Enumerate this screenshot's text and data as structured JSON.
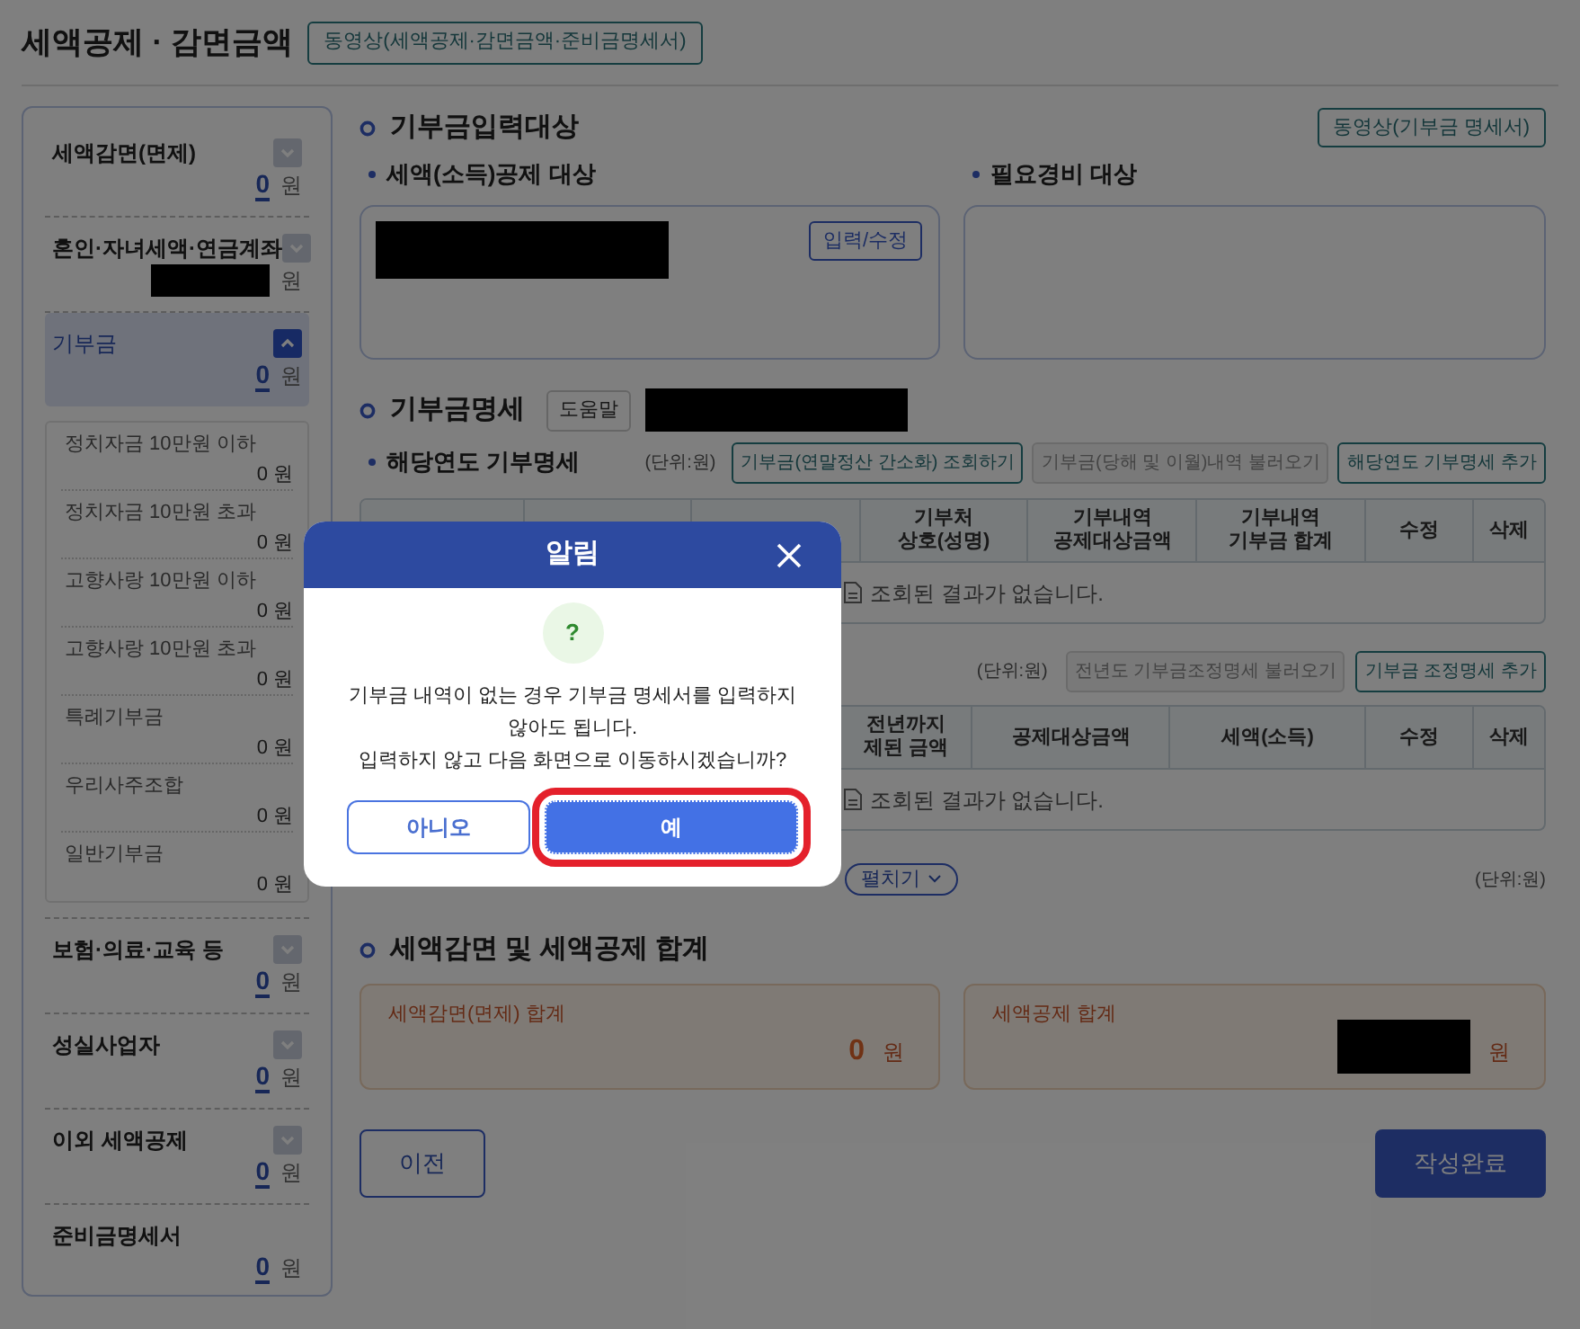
{
  "page_title": "세액공제 · 감면금액",
  "video_button": "동영상(세액공제·감면금액·준비금명세서)",
  "sidebar": {
    "items": [
      {
        "label": "세액감면(면제)",
        "amount": "0",
        "unit": "원",
        "selected": false,
        "expanded": false
      },
      {
        "label": "혼인·자녀세액·연금계좌",
        "unit": "원",
        "selected": false,
        "expanded": false
      },
      {
        "label": "기부금",
        "amount": "0",
        "unit": "원",
        "selected": true,
        "expanded": true,
        "children": [
          {
            "label": "정치자금 10만원 이하",
            "amount": "0 원"
          },
          {
            "label": "정치자금 10만원 초과",
            "amount": "0 원"
          },
          {
            "label": "고향사랑 10만원 이하",
            "amount": "0 원"
          },
          {
            "label": "고향사랑 10만원 초과",
            "amount": "0 원"
          },
          {
            "label": "특례기부금",
            "amount": "0 원"
          },
          {
            "label": "우리사주조합",
            "amount": "0 원"
          },
          {
            "label": "일반기부금",
            "amount": "0 원"
          }
        ]
      },
      {
        "label": "보험·의료·교육 등",
        "amount": "0",
        "unit": "원",
        "selected": false,
        "expanded": false
      },
      {
        "label": "성실사업자",
        "amount": "0",
        "unit": "원",
        "selected": false,
        "expanded": false
      },
      {
        "label": "이외 세액공제",
        "amount": "0",
        "unit": "원",
        "selected": false,
        "expanded": false
      },
      {
        "label": "준비금명세서",
        "amount": "0",
        "unit": "원",
        "selected": false
      }
    ]
  },
  "input_target": {
    "title": "기부금입력대상",
    "video_button": "동영상(기부금 명세서)",
    "deduction_label": "세액(소득)공제 대상",
    "edit_button": "입력/수정",
    "expense_label": "필요경비 대상"
  },
  "donation_detail": {
    "title": "기부금명세",
    "help_button": "도움말",
    "subtitle": "해당연도 기부명세",
    "unit": "(단위:원)",
    "buttons": [
      {
        "label": "기부금(연말정산 간소화) 조회하기",
        "disabled": false
      },
      {
        "label": "기부금(당해 및 이월)내역 불러오기",
        "disabled": true
      },
      {
        "label": "해당연도 기부명세 추가",
        "disabled": false
      }
    ],
    "columns": [
      [
        "기부처",
        "상호(성명)"
      ],
      [
        "기부내역",
        "공제대상금액"
      ],
      [
        "기부내역",
        "기부금 합계"
      ],
      [
        "수정"
      ],
      [
        "삭제"
      ]
    ],
    "empty_text": "조회된 결과가 없습니다."
  },
  "adjustment": {
    "unit": "(단위:원)",
    "buttons": [
      {
        "label": "전년도 기부금조정명세 불러오기",
        "disabled": true
      },
      {
        "label": "기부금 조정명세 추가",
        "disabled": false
      }
    ],
    "columns": [
      [
        "전년까지",
        "제된 금액"
      ],
      [
        "공제대상금액"
      ],
      [
        "세액(소득)"
      ],
      [
        "수정"
      ],
      [
        "삭제"
      ]
    ],
    "empty_text": "조회된 결과가 없습니다."
  },
  "expand_row": {
    "button": "펼치기",
    "unit": "(단위:원)"
  },
  "totals": {
    "title": "세액감면 및 세액공제 합계",
    "cards": [
      {
        "label": "세액감면(면제) 합계",
        "amount": "0",
        "unit": "원"
      },
      {
        "label": "세액공제 합계",
        "unit": "원"
      }
    ]
  },
  "footer": {
    "prev_button": "이전",
    "done_button": "작성완료"
  },
  "dialog": {
    "title": "알림",
    "icon_text": "?",
    "message": [
      "기부금 내역이 없는 경우 기부금 명세서를 입력하지 않아도 됩니다.",
      "입력하지 않고 다음 화면으로 이동하시겠습니까?"
    ],
    "buttons": [
      {
        "label": "아니오",
        "selected": false
      },
      {
        "label": "예",
        "selected": true
      }
    ]
  }
}
